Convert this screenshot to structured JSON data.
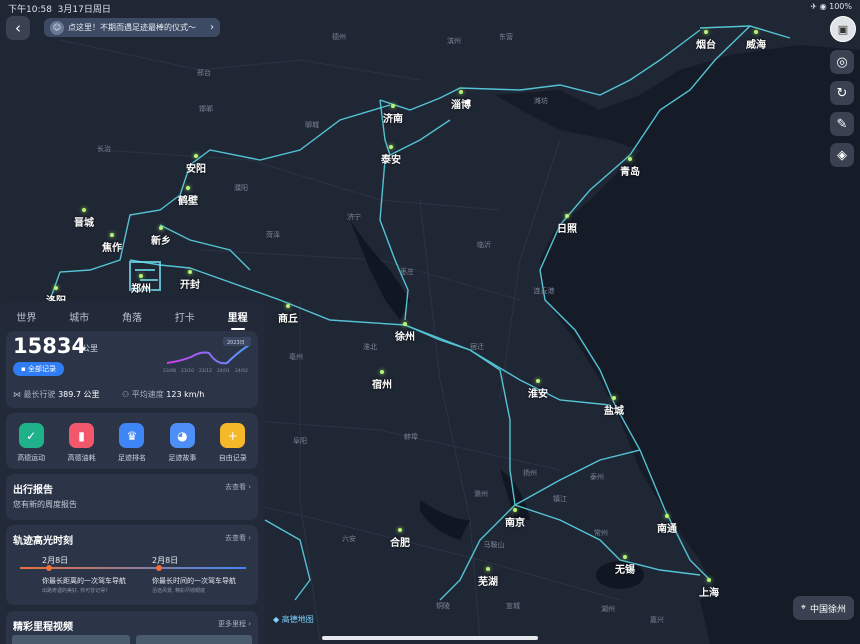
{
  "status": {
    "time": "下午10:58",
    "date": "3月17日周日",
    "right": "✈ ◉ 100%"
  },
  "banner": {
    "text": "点这里！不期而遇足迹最棒的仪式～"
  },
  "cities": [
    {
      "name": "烟台"
    },
    {
      "name": "威海"
    },
    {
      "name": "淄博"
    },
    {
      "name": "济南"
    },
    {
      "name": "泰安"
    },
    {
      "name": "青岛"
    },
    {
      "name": "日照"
    },
    {
      "name": "安阳"
    },
    {
      "name": "鹤壁"
    },
    {
      "name": "晋城"
    },
    {
      "name": "焦作"
    },
    {
      "name": "新乡"
    },
    {
      "name": "洛阳"
    },
    {
      "name": "郑州"
    },
    {
      "name": "开封"
    },
    {
      "name": "商丘"
    },
    {
      "name": "徐州"
    },
    {
      "name": "宿州"
    },
    {
      "name": "淮安"
    },
    {
      "name": "盐城"
    },
    {
      "name": "南京"
    },
    {
      "name": "合肥"
    },
    {
      "name": "南通"
    },
    {
      "name": "无锡"
    },
    {
      "name": "芜湖"
    },
    {
      "name": "上海"
    }
  ],
  "towns": [
    "德州",
    "滨州",
    "东营",
    "潍坊",
    "邢台",
    "邯郸",
    "聊城",
    "长治",
    "濮阳",
    "济宁",
    "菏泽",
    "临沂",
    "枣庄",
    "连云港",
    "宿迁",
    "淮北",
    "亳州",
    "蚌埠",
    "阜阳",
    "滁州",
    "扬州",
    "泰州",
    "镇江",
    "常州",
    "六安",
    "马鞍山",
    "铜陵",
    "宣城",
    "湖州",
    "嘉兴"
  ],
  "location": {
    "label": "中国徐州"
  },
  "logo": "高德地图",
  "panel": {
    "tabs": [
      "世界",
      "城市",
      "角落",
      "打卡",
      "里程"
    ],
    "km": {
      "value": "15834",
      "unit": "公里",
      "all_records": "全部记录"
    },
    "mini_chart": {
      "labels": [
        "23/08",
        "23/10",
        "23/12",
        "24/01",
        "24/02"
      ],
      "badge": "2023日"
    },
    "longest": {
      "label": "最长行驶",
      "value": "389.7 公里"
    },
    "speed": {
      "label": "平均速度",
      "value": "123 km/h"
    },
    "grid": [
      {
        "label": "高德运动",
        "color": "#1fb18a",
        "icon": "✓"
      },
      {
        "label": "高德油耗",
        "color": "#f2576b",
        "icon": "▮"
      },
      {
        "label": "足迹排名",
        "color": "#3e86f5",
        "icon": "♛"
      },
      {
        "label": "足迹故事",
        "color": "#4d8ef7",
        "icon": "◕"
      },
      {
        "label": "自由记录",
        "color": "#f5b829",
        "icon": "+"
      }
    ],
    "report": {
      "title": "出行报告",
      "sub": "您有新的周度报告",
      "link": "去查看 ›"
    },
    "highlight": {
      "title": "轨迹高光时刻",
      "link": "去查看 ›",
      "items": [
        {
          "date": "2月8日",
          "text": "你最长距离的一次驾车导航",
          "sub": "出路奇遇的美好, 你可曾记得?"
        },
        {
          "date": "2月8日",
          "text": "你最长时间的一次驾车导航",
          "sub": "沿途风景, 精彩尽收眼底"
        }
      ]
    },
    "video": {
      "title": "精彩里程视频",
      "link": "更多里程 ›"
    }
  }
}
